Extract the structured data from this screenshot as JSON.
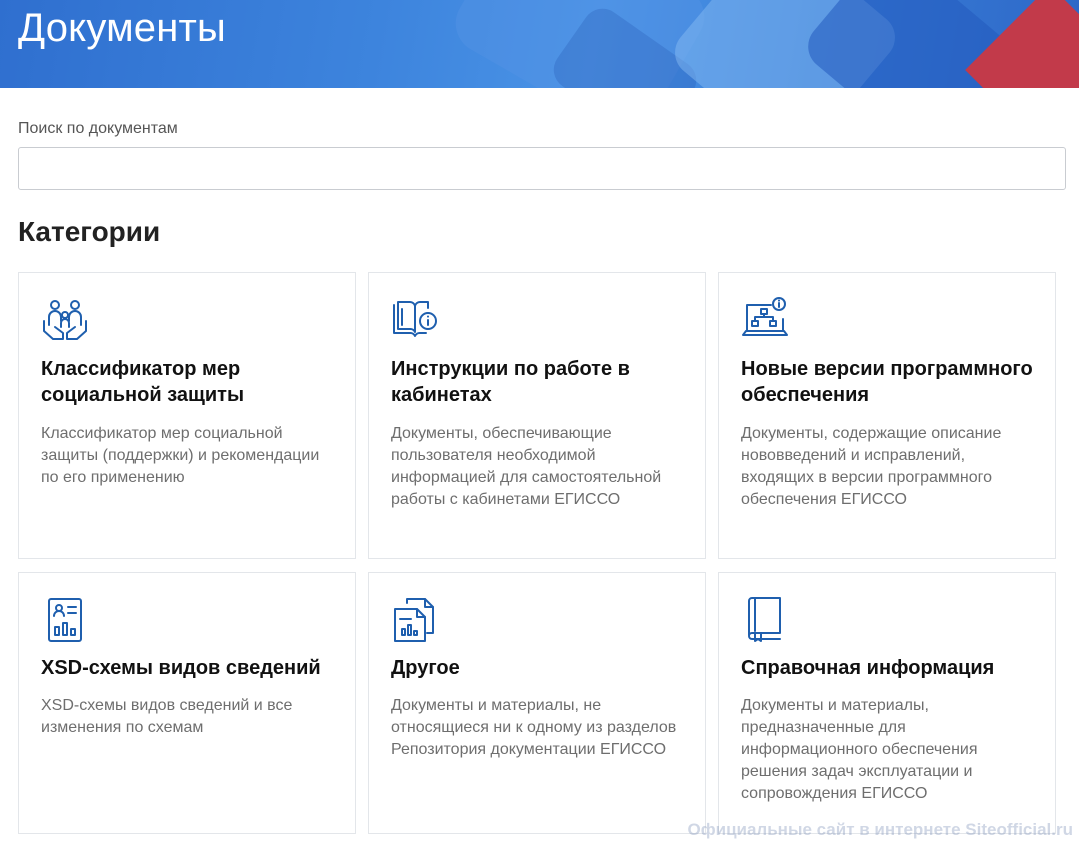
{
  "header": {
    "title": "Документы"
  },
  "search": {
    "label": "Поиск по документам",
    "placeholder": "",
    "value": ""
  },
  "categories": {
    "heading": "Категории",
    "items": [
      {
        "icon": "family-care-icon",
        "title": "Классификатор мер социальной защиты",
        "description": "Классификатор мер социальной защиты (поддержки) и рекомендации по его применению"
      },
      {
        "icon": "book-info-icon",
        "title": "Инструкции по работе в кабинетах",
        "description": "Документы, обеспечивающие пользователя необходимой информацией для самостоятельной работы с кабинетами ЕГИССО"
      },
      {
        "icon": "laptop-info-icon",
        "title": "Новые версии программного обеспечения",
        "description": "Документы, содержащие описание нововведений и исправлений, входящих в версии программного обеспечения ЕГИССО"
      },
      {
        "icon": "document-chart-icon",
        "title": "XSD-схемы видов сведений",
        "description": "XSD-схемы видов сведений и все изменения по схемам"
      },
      {
        "icon": "documents-stack-icon",
        "title": "Другое",
        "description": "Документы и материалы, не относящиеся ни к одному из разделов Репозитория документации ЕГИССО"
      },
      {
        "icon": "reference-book-icon",
        "title": "Справочная информация",
        "description": "Документы и материалы, предназначенные для информационного обеспечения решения задач эксплуатации и сопровождения ЕГИССО"
      }
    ]
  },
  "watermark": "Официальные сайт в интернете Siteofficial.ru",
  "colors": {
    "accent": "#1f5fae",
    "banner": "#3d84dd",
    "banner_red": "#c23a4a"
  }
}
